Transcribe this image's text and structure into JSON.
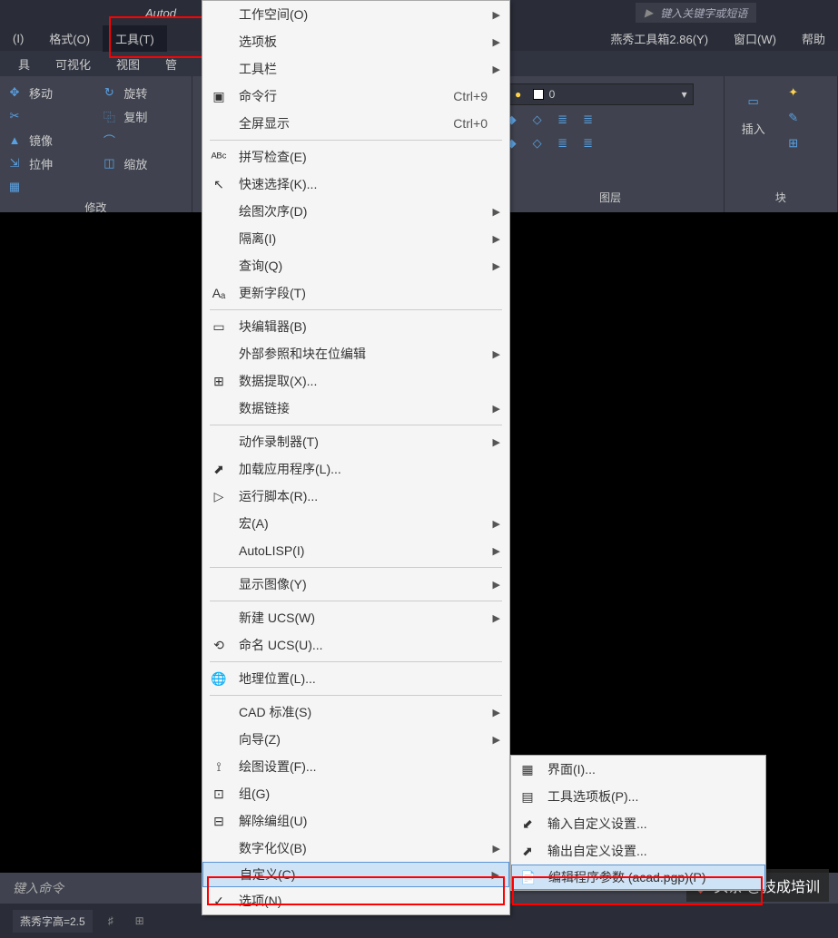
{
  "title": "Autod",
  "search_placeholder": "键入关键字或短语",
  "menubar": {
    "items": [
      "(I)",
      "格式(O)",
      "工具(T)"
    ],
    "items_r": [
      "燕秀工具箱2.86(Y)",
      "窗口(W)",
      "帮助"
    ]
  },
  "tabs": [
    "具",
    "可视化",
    "视图",
    "管"
  ],
  "modify_panel": {
    "title": "修改",
    "items": [
      "移动",
      "旋转",
      "复制",
      "镜像",
      "拉伸",
      "缩放"
    ]
  },
  "layer_panel": {
    "title": "图层",
    "value": "0"
  },
  "block_panel": {
    "title": "块",
    "insert": "插入"
  },
  "command_placeholder": "键入命令",
  "status": {
    "fontheight": "燕秀字高=2.5"
  },
  "watermark": "头条 @技成培训",
  "tools_menu": [
    {
      "label": "工作空间(O)",
      "arrow": true
    },
    {
      "label": "选项板",
      "arrow": true
    },
    {
      "label": "工具栏",
      "arrow": true
    },
    {
      "label": "命令行",
      "shortcut": "Ctrl+9",
      "icon": "terminal"
    },
    {
      "label": "全屏显示",
      "shortcut": "Ctrl+0"
    },
    {
      "sep": true
    },
    {
      "label": "拼写检查(E)",
      "icon": "abc"
    },
    {
      "label": "快速选择(K)...",
      "icon": "select"
    },
    {
      "label": "绘图次序(D)",
      "arrow": true
    },
    {
      "label": "隔离(I)",
      "arrow": true
    },
    {
      "label": "查询(Q)",
      "arrow": true
    },
    {
      "label": "更新字段(T)",
      "icon": "field"
    },
    {
      "sep": true
    },
    {
      "label": "块编辑器(B)",
      "icon": "block"
    },
    {
      "label": "外部参照和块在位编辑",
      "arrow": true
    },
    {
      "label": "数据提取(X)...",
      "icon": "extract"
    },
    {
      "label": "数据链接",
      "arrow": true
    },
    {
      "sep": true
    },
    {
      "label": "动作录制器(T)",
      "arrow": true
    },
    {
      "label": "加载应用程序(L)...",
      "icon": "load"
    },
    {
      "label": "运行脚本(R)...",
      "icon": "script"
    },
    {
      "label": "宏(A)",
      "arrow": true
    },
    {
      "label": "AutoLISP(I)",
      "arrow": true
    },
    {
      "sep": true
    },
    {
      "label": "显示图像(Y)",
      "arrow": true
    },
    {
      "sep": true
    },
    {
      "label": "新建 UCS(W)",
      "arrow": true
    },
    {
      "label": "命名 UCS(U)...",
      "icon": "ucs"
    },
    {
      "sep": true
    },
    {
      "label": "地理位置(L)...",
      "icon": "globe"
    },
    {
      "sep": true
    },
    {
      "label": "CAD 标准(S)",
      "arrow": true
    },
    {
      "label": "向导(Z)",
      "arrow": true
    },
    {
      "label": "绘图设置(F)...",
      "icon": "draft"
    },
    {
      "label": "组(G)",
      "icon": "group"
    },
    {
      "label": "解除编组(U)",
      "icon": "ungroup"
    },
    {
      "label": "数字化仪(B)",
      "arrow": true
    },
    {
      "label": "自定义(C)",
      "arrow": true,
      "highlight": true
    },
    {
      "label": "选项(N)...",
      "icon": "options"
    }
  ],
  "customize_submenu": [
    {
      "label": "界面(I)...",
      "icon": "cui"
    },
    {
      "label": "工具选项板(P)...",
      "icon": "palette"
    },
    {
      "label": "输入自定义设置...",
      "icon": "import"
    },
    {
      "label": "输出自定义设置...",
      "icon": "export"
    },
    {
      "label": "编辑程序参数 (acad.pgp)(P)",
      "icon": "pgp",
      "highlight": true
    }
  ]
}
